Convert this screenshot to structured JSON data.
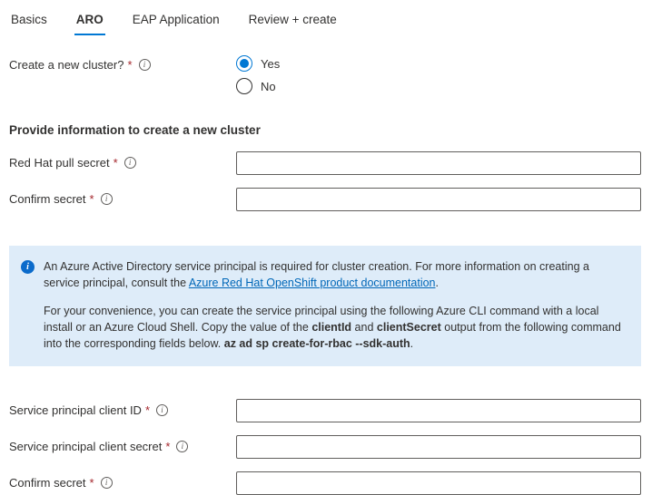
{
  "tabs": {
    "items": [
      {
        "label": "Basics",
        "active": false
      },
      {
        "label": "ARO",
        "active": true
      },
      {
        "label": "EAP Application",
        "active": false
      },
      {
        "label": "Review + create",
        "active": false
      }
    ]
  },
  "markers": {
    "required": "*",
    "info_icon": "i"
  },
  "create_cluster": {
    "label": "Create a new cluster?",
    "options": {
      "yes": "Yes",
      "no": "No"
    },
    "selected": "Yes"
  },
  "section": {
    "heading": "Provide information to create a new cluster"
  },
  "fields": {
    "pull_secret": {
      "label": "Red Hat pull secret",
      "value": ""
    },
    "confirm_secret_1": {
      "label": "Confirm secret",
      "value": ""
    },
    "sp_client_id": {
      "label": "Service principal client ID",
      "value": ""
    },
    "sp_client_secret": {
      "label": "Service principal client secret",
      "value": ""
    },
    "confirm_secret_2": {
      "label": "Confirm secret",
      "value": ""
    }
  },
  "info_box": {
    "p1_text": "An Azure Active Directory service principal is required for cluster creation. For more information on creating a service principal, consult the ",
    "p1_link": "Azure Red Hat OpenShift product documentation",
    "p1_end": ".",
    "p2_a": "For your convenience, you can create the service principal using the following Azure CLI command with a local install or an Azure Cloud Shell. Copy the value of the ",
    "p2_bold1": "clientId",
    "p2_b": " and ",
    "p2_bold2": "clientSecret",
    "p2_c": " output from the following command into the corresponding fields below.  ",
    "p2_command": "az ad sp create-for-rbac --sdk-auth",
    "p2_end": "."
  },
  "colors": {
    "accent": "#0078d4",
    "required_marker": "#a4262c",
    "info_background": "#deecf9",
    "link": "#0067b8"
  }
}
